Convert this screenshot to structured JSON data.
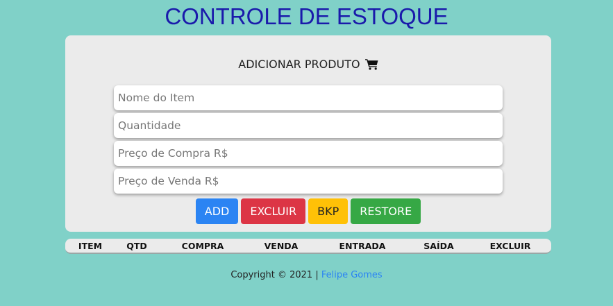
{
  "page_title": "CONTROLE DE ESTOQUE",
  "form": {
    "heading": "ADICIONAR PRODUTO",
    "heading_icon": "shopping-cart-icon",
    "fields": [
      {
        "placeholder": "Nome do Item",
        "value": ""
      },
      {
        "placeholder": "Quantidade",
        "value": ""
      },
      {
        "placeholder": "Preço de Compra R$",
        "value": ""
      },
      {
        "placeholder": "Preço de Venda R$",
        "value": ""
      }
    ],
    "buttons": {
      "add": "ADD",
      "excluir": "EXCLUIR",
      "bkp": "BKP",
      "restore": "RESTORE"
    }
  },
  "table": {
    "columns": [
      "ITEM",
      "QTD",
      "COMPRA",
      "VENDA",
      "ENTRADA",
      "SAÍDA",
      "EXCLUIR"
    ]
  },
  "footer": {
    "copyright": "Copyright © 2021 |",
    "author_link": "Felipe Gomes"
  },
  "colors": {
    "background": "#80d1c8",
    "title": "#1a1aab",
    "add": "#2b84f3",
    "excluir": "#dc3545",
    "bkp": "#ffc107",
    "restore": "#36a845",
    "link": "#2b84f3"
  }
}
